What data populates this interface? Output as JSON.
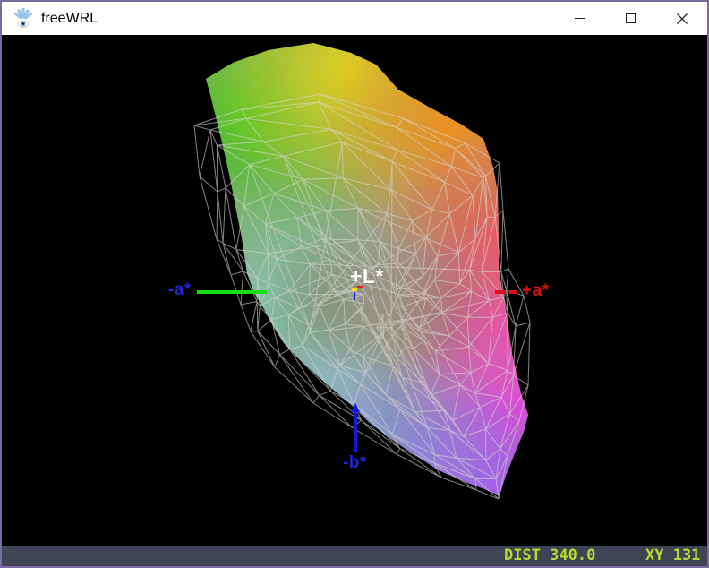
{
  "window": {
    "title": "freeWRL"
  },
  "colors": {
    "window_border": "#7a6ba3",
    "titlebar_bg": "#ffffff",
    "title_text": "#000000",
    "viewport_bg": "#000000",
    "statusbar_bg": "#3f4354",
    "statusbar_text": "#b6da2d",
    "wireframe": "#d8d8d2",
    "axis_a_negative_green": "#17dd17",
    "axis_a_positive_red": "#dd1111",
    "axis_b_negative_blue": "#1717dd",
    "label_blue": "#2026d0",
    "label_red": "#dd0f0f",
    "label_white": "#ffffff",
    "origin_marker_yellow": "#f2e11a",
    "origin_marker_red": "#e02020",
    "origin_marker_blue": "#2626e0"
  },
  "viewport": {
    "axis_labels": {
      "neg_a": "-a*",
      "pos_a": "+a*",
      "pos_l": "+L*",
      "neg_b": "-b*"
    },
    "gamut_palette": {
      "base": "#97a083",
      "green": "#46c621",
      "yellow": "#e4d11c",
      "orange": "#f08e1c",
      "red": "#ec5555",
      "pink": "#e85590",
      "magenta": "#e945d6",
      "purple": "#a457ef",
      "lavender": "#8d7ce2",
      "steel": "#7f96d0",
      "sky": "#96b7d2",
      "teal": "#82c3ad",
      "olive": "#6e7a5e",
      "brown": "#97686e",
      "gray": "#9b9188"
    }
  },
  "statusbar": {
    "dist": "DIST 340.0",
    "xy": "XY 131"
  }
}
